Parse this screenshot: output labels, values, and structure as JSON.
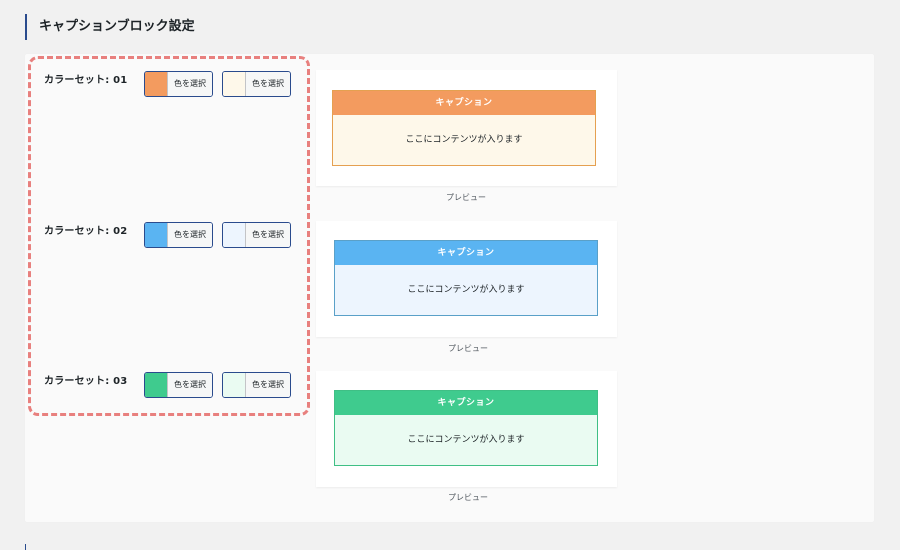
{
  "section": {
    "title": "キャプションブロック設定"
  },
  "color_sets": [
    {
      "label": "カラーセット: 01",
      "primary": {
        "color": "#f39b5f",
        "button_label": "色を選択"
      },
      "secondary": {
        "color": "#fef8ea",
        "button_label": "色を選択"
      },
      "preview": {
        "caption": "キャプション",
        "content": "ここにコンテンツが入ります",
        "label": "プレビュー",
        "border_color": "#e5a050"
      }
    },
    {
      "label": "カラーセット: 02",
      "primary": {
        "color": "#5ab4f2",
        "button_label": "色を選択"
      },
      "secondary": {
        "color": "#edf5fe",
        "button_label": "色を選択"
      },
      "preview": {
        "caption": "キャプション",
        "content": "ここにコンテンツが入ります",
        "label": "プレビュー",
        "border_color": "#5aa0c8"
      }
    },
    {
      "label": "カラーセット: 03",
      "primary": {
        "color": "#3fcb8e",
        "button_label": "色を選択"
      },
      "secondary": {
        "color": "#eafbf2",
        "button_label": "色を選択"
      },
      "preview": {
        "caption": "キャプション",
        "content": "ここにコンテンツが入ります",
        "label": "プレビュー",
        "border_color": "#3fbf85"
      }
    }
  ]
}
